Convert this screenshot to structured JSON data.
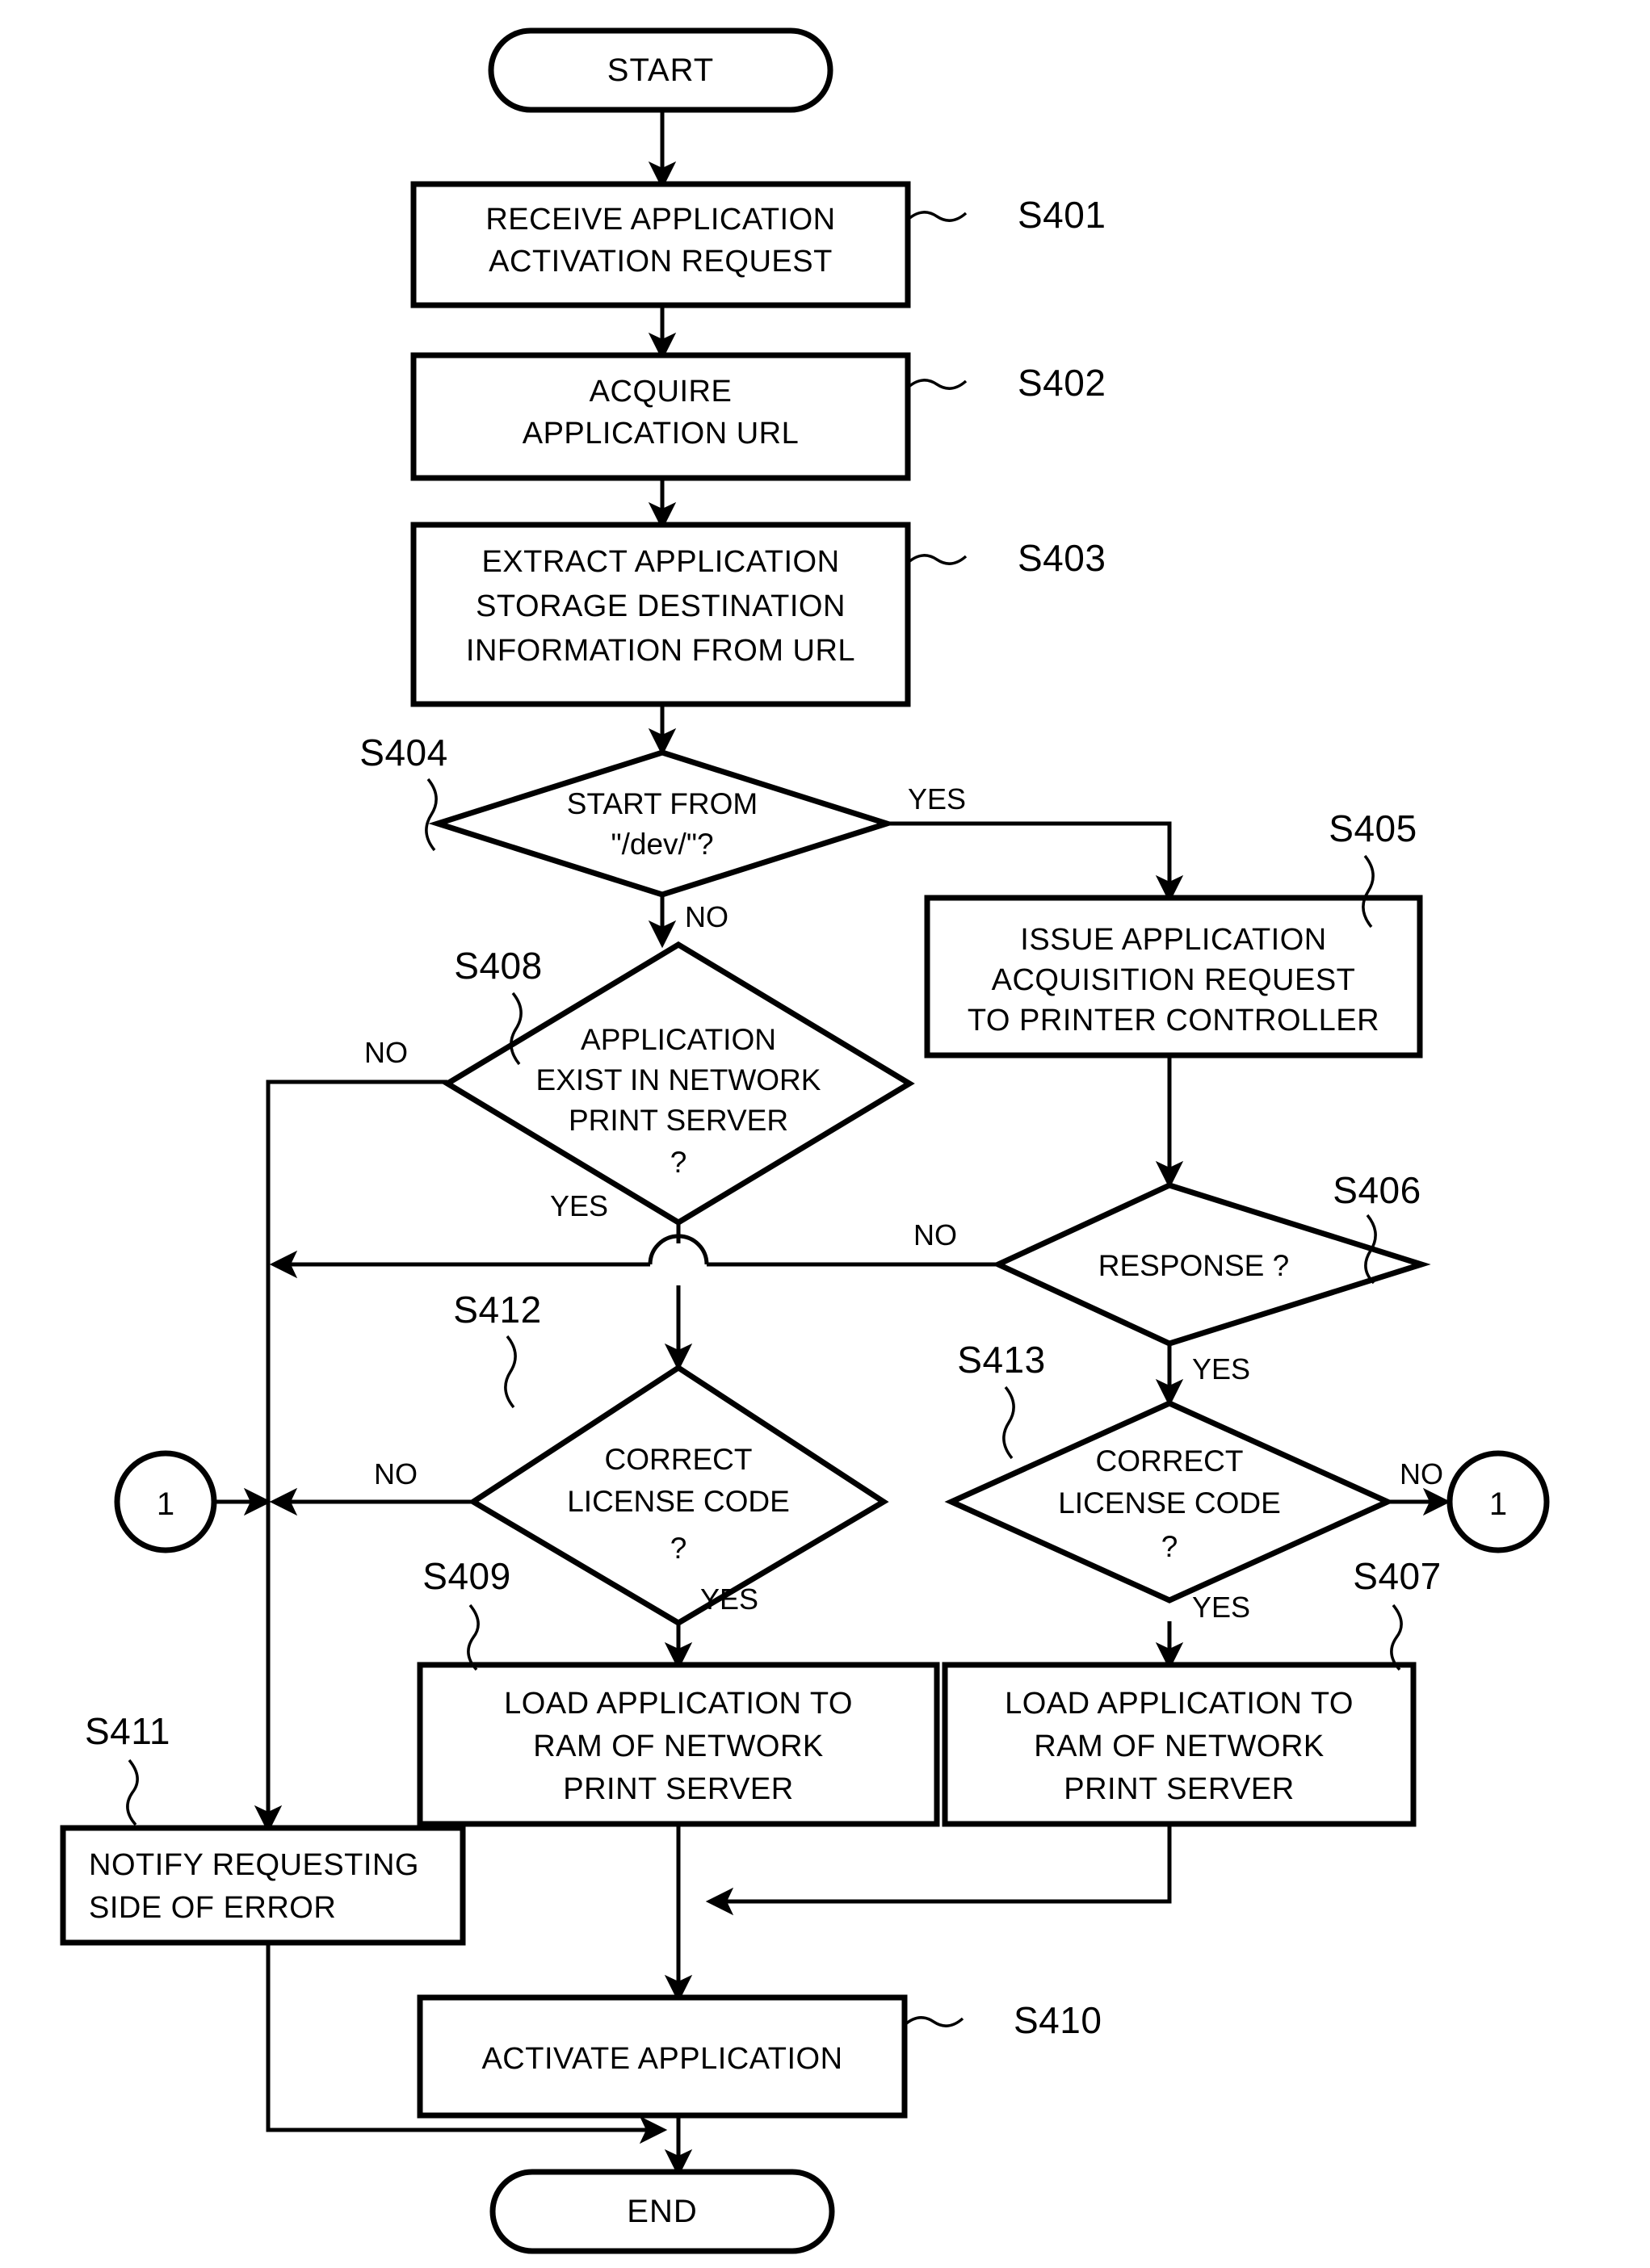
{
  "figure": {
    "kind": "flowchart",
    "orientation": "vertical",
    "background": "#ffffff",
    "stroke_color": "#000000"
  },
  "terminals": {
    "start": "START",
    "end": "END"
  },
  "process_boxes": [
    {
      "id": "S401",
      "step": "S401",
      "lines": [
        "RECEIVE APPLICATION",
        "ACTIVATION REQUEST"
      ]
    },
    {
      "id": "S402",
      "step": "S402",
      "lines": [
        "ACQUIRE",
        "APPLICATION URL"
      ]
    },
    {
      "id": "S403",
      "step": "S403",
      "lines": [
        "EXTRACT APPLICATION",
        "STORAGE DESTINATION",
        "INFORMATION FROM URL"
      ]
    },
    {
      "id": "S405",
      "step": "S405",
      "lines": [
        "ISSUE APPLICATION",
        "ACQUISITION REQUEST",
        "TO PRINTER CONTROLLER"
      ]
    },
    {
      "id": "S409",
      "step": "S409",
      "lines": [
        "LOAD APPLICATION TO",
        "RAM OF NETWORK",
        "PRINT SERVER"
      ]
    },
    {
      "id": "S407",
      "step": "S407",
      "lines": [
        "LOAD APPLICATION TO",
        "RAM OF NETWORK",
        "PRINT SERVER"
      ]
    },
    {
      "id": "S411",
      "step": "S411",
      "lines": [
        "NOTIFY REQUESTING",
        "SIDE OF ERROR"
      ]
    },
    {
      "id": "S410",
      "step": "S410",
      "lines": [
        "ACTIVATE APPLICATION"
      ]
    }
  ],
  "decisions": [
    {
      "id": "S404",
      "step": "S404",
      "lines": [
        "START FROM",
        "\"/dev/\"?"
      ],
      "yes": "YES",
      "no": "NO"
    },
    {
      "id": "S408",
      "step": "S408",
      "lines": [
        "APPLICATION",
        "EXIST IN NETWORK",
        "PRINT SERVER",
        "?"
      ],
      "yes": "YES",
      "no": "NO"
    },
    {
      "id": "S406",
      "step": "S406",
      "lines": [
        "RESPONSE ?"
      ],
      "yes": "YES",
      "no": "NO"
    },
    {
      "id": "S412",
      "step": "S412",
      "lines": [
        "CORRECT",
        "LICENSE CODE",
        "?"
      ],
      "yes": "YES",
      "no": "NO"
    },
    {
      "id": "S413",
      "step": "S413",
      "lines": [
        "CORRECT",
        "LICENSE CODE",
        "?"
      ],
      "yes": "YES",
      "no": "NO"
    }
  ],
  "connectors": [
    {
      "id": "conn-left",
      "label": "1"
    },
    {
      "id": "conn-right",
      "label": "1"
    }
  ],
  "edge_labels": {
    "s404_yes": "YES",
    "s404_no": "NO",
    "s408_no": "NO",
    "s408_yes": "YES",
    "s406_no": "NO",
    "s406_yes": "YES",
    "s412_no": "NO",
    "s412_yes": "YES",
    "s413_no": "NO",
    "s413_yes": "YES"
  },
  "step_labels": {
    "S401": "S401",
    "S402": "S402",
    "S403": "S403",
    "S404": "S404",
    "S405": "S405",
    "S406": "S406",
    "S407": "S407",
    "S408": "S408",
    "S409": "S409",
    "S410": "S410",
    "S411": "S411",
    "S412": "S412",
    "S413": "S413"
  }
}
